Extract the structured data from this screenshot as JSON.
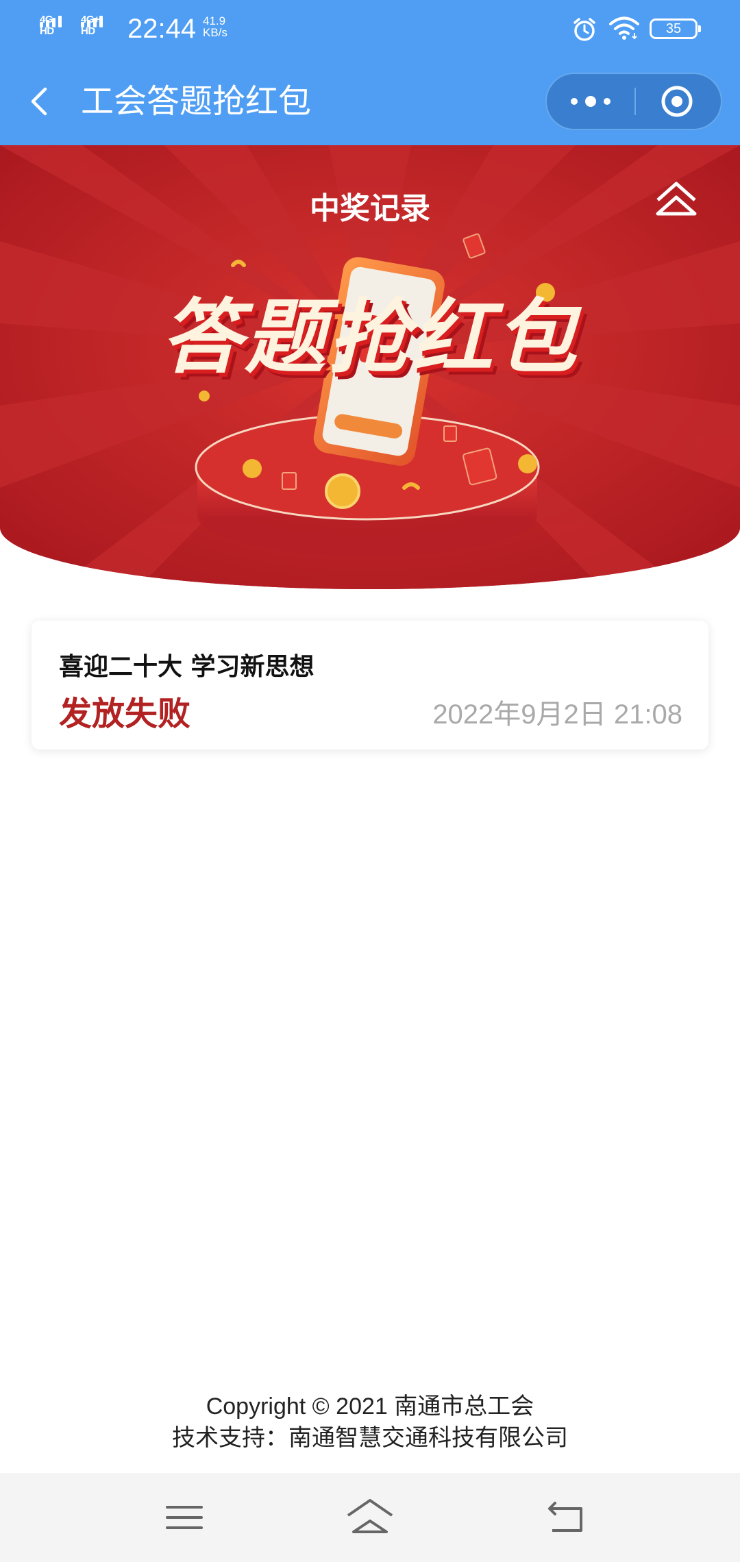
{
  "status_bar": {
    "network_1": "4G HD",
    "network_2": "4G+ HD",
    "time": "22:44",
    "speed_value": "41.9",
    "speed_unit": "KB/s",
    "battery": "35",
    "icons": [
      "alarm-icon",
      "wifi-icon",
      "battery-icon"
    ]
  },
  "navbar": {
    "title": "工会答题抢红包",
    "icons": [
      "back-arrow-icon",
      "more-dots-icon",
      "close-target-icon"
    ],
    "background": "#4f9ef3"
  },
  "banner": {
    "title": "中奖记录",
    "headline": "答题抢红包",
    "icons": [
      "home-icon",
      "phone-illustration",
      "coin-icon",
      "red-envelope-icon"
    ],
    "background": "#b8252a"
  },
  "record": {
    "title": "喜迎二十大 学习新思想",
    "status": "发放失败",
    "time": "2022年9月2日 21:08",
    "status_color": "#b22222"
  },
  "footer": {
    "copyright": "Copyright © 2021 南通市总工会",
    "support": "技术支持：南通智慧交通科技有限公司"
  },
  "system_nav": {
    "icons": [
      "menu-icon",
      "home-icon",
      "back-icon"
    ]
  }
}
